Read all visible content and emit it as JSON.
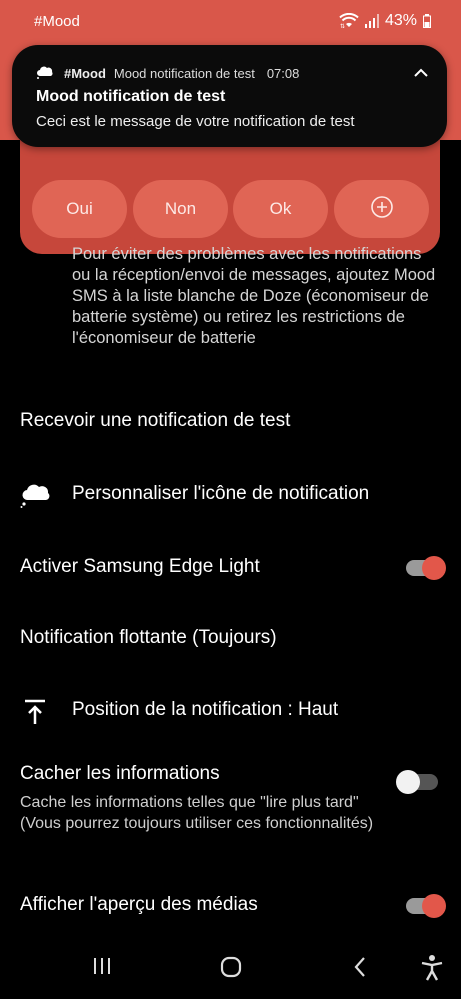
{
  "status_bar": {
    "title": "#Mood",
    "battery": "43%",
    "icons": [
      "wifi-icon",
      "signal-icon",
      "battery-icon"
    ],
    "color": "#d9574a"
  },
  "notification": {
    "app_name": "#Mood",
    "channel": "Mood notification de test",
    "time": "07:08",
    "title": "Mood notification de test",
    "body": "Ceci est le message de votre notification de test"
  },
  "actions": {
    "yes": "Oui",
    "no": "Non",
    "ok": "Ok",
    "more_icon": "plus-circle-icon"
  },
  "settings": {
    "doze_text": "Pour éviter des problèmes avec les notifications ou la réception/envoi de messages, ajoutez Mood SMS à la liste blanche de Doze (économiseur de batterie système) ou retirez les restrictions de l'économiseur de batterie",
    "test_notification": "Recevoir une notification de test",
    "custom_icon": "Personnaliser l'icône de notification",
    "edge_light": {
      "label": "Activer Samsung Edge Light",
      "enabled": true
    },
    "floating": "Notification flottante (Toujours)",
    "position": "Position de la notification : Haut",
    "hide_info": {
      "label": "Cacher les informations",
      "description": "Cache les informations telles que \"lire plus tard\" (Vous pourrez toujours utiliser ces fonctionnalités)",
      "enabled": false
    },
    "media_preview": {
      "label": "Afficher l'aperçu des médias",
      "enabled": true
    }
  },
  "nav_bar": {
    "icons": [
      "recents-icon",
      "home-icon",
      "back-icon",
      "accessibility-icon"
    ]
  },
  "colors": {
    "accent": "#e2574a",
    "panel": "#c6473b",
    "button": "#e06555"
  }
}
